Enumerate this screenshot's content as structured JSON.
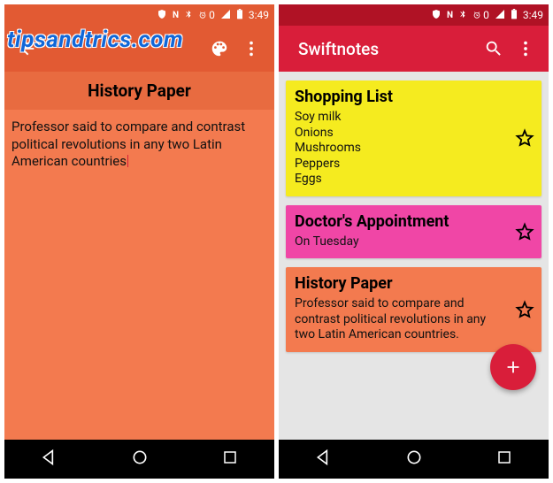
{
  "watermark": "tipsandtrics.com",
  "status": {
    "time": "3:49",
    "alarm_pct": "0",
    "icons": [
      "antivirus",
      "nfc",
      "bluetooth",
      "alarm",
      "signal",
      "battery"
    ]
  },
  "editor_screen": {
    "note": {
      "title": "History Paper",
      "body": "Professor said to compare and contrast political revolutions in any two Latin American countries"
    }
  },
  "list_screen": {
    "app_title": "Swiftnotes",
    "notes": [
      {
        "title": "Shopping List",
        "body": "Soy milk\nOnions\nMushrooms\nPeppers\nEggs",
        "color": "#f5eb1f",
        "starred": false
      },
      {
        "title": "Doctor's Appointment",
        "body": "On Tuesday",
        "color": "#f046a6",
        "starred": false
      },
      {
        "title": "History Paper",
        "body": "Professor said to compare and contrast political revolutions in any two Latin American countries.",
        "color": "#f37a4f",
        "starred": false
      }
    ]
  },
  "colors": {
    "accent_red": "#d91e3a",
    "accent_orange": "#f37a4f"
  }
}
